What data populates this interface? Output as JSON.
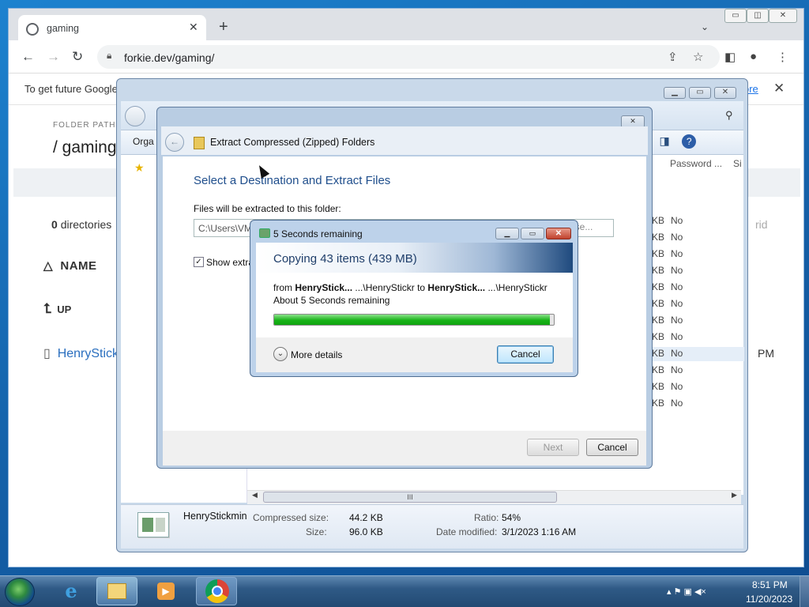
{
  "browser": {
    "tab_title": "gaming",
    "tab_close": "✕",
    "new_tab": "+",
    "tab_search": "⌄",
    "url": "forkie.dev/gaming/",
    "window_minimize": "▭",
    "window_restore": "◫",
    "window_close": "✕",
    "infobar_text": "To get future Google",
    "infobar_link": "ore",
    "infobar_close": "✕"
  },
  "web": {
    "folder_path_label": "FOLDER PATH",
    "folder_path": "/ gaming",
    "dir_count": "0",
    "dir_label": "directories",
    "grid_label": "rid",
    "name_header": "NAME",
    "up_label": "UP",
    "file_name": "HenryStick",
    "file_time": "PM"
  },
  "explorer": {
    "organize_label": "Orga",
    "col_password": "Password ...",
    "col_si": "Si",
    "rows": [
      {
        "size": "KB",
        "pass": "No"
      },
      {
        "size": "KB",
        "pass": "No"
      },
      {
        "size": "KB",
        "pass": "No"
      },
      {
        "size": "KB",
        "pass": "No"
      },
      {
        "size": "KB",
        "pass": "No"
      },
      {
        "size": "KB",
        "pass": "No"
      },
      {
        "size": "KB",
        "pass": "No"
      },
      {
        "size": "KB",
        "pass": "No"
      },
      {
        "size": "KB",
        "pass": "No"
      },
      {
        "size": "KB",
        "pass": "No"
      },
      {
        "size": "KB",
        "pass": "No"
      },
      {
        "size": "KB",
        "pass": "No"
      }
    ],
    "scroll_thumb": "III",
    "detail": {
      "name": "HenryStickmin",
      "compressed_label": "Compressed size:",
      "compressed_value": "44.2 KB",
      "size_label": "Size:",
      "size_value": "96.0 KB",
      "ratio_label": "Ratio:",
      "ratio_value": "54%",
      "modified_label": "Date modified:",
      "modified_value": "3/1/2023 1:16 AM"
    }
  },
  "wizard": {
    "title": "Extract Compressed (Zipped) Folders",
    "heading": "Select a Destination and Extract Files",
    "dest_label": "Files will be extracted to this folder:",
    "dest_path": "C:\\Users\\VM",
    "browse_label": "wse...",
    "show_extracted_label": "Show extra",
    "next_label": "Next",
    "cancel_label": "Cancel",
    "close_glyph": "✕"
  },
  "copy_dialog": {
    "title": "5 Seconds remaining",
    "heading": "Copying 43 items (439 MB)",
    "from_prefix": "from ",
    "from_source": "HenryStick...",
    "from_source_path": " ...\\HenryStickr",
    "to_word": " to ",
    "to_dest": "HenryStick...",
    "to_dest_path": " ...\\HenryStickr",
    "remaining": "About 5 Seconds remaining",
    "progress": 0.985,
    "more_details": "More details",
    "cancel_label": "Cancel",
    "min_glyph": "▁",
    "max_glyph": "▭",
    "close_glyph": "✕"
  },
  "taskbar": {
    "clock_time": "8:51 PM",
    "clock_date": "11/20/2023",
    "tray_glyphs": "▴ ⚑ ▣ ◀×"
  },
  "colors": {
    "progress_green": "#19b319",
    "link_blue": "#2a6fbf"
  }
}
